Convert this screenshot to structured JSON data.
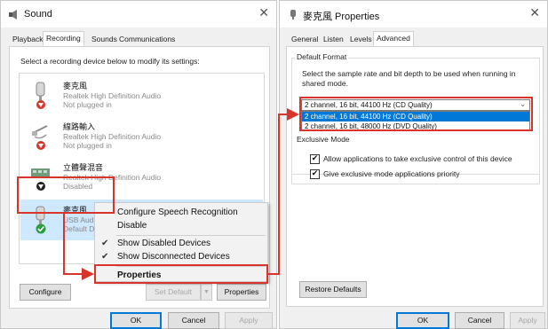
{
  "sound_dialog": {
    "title": "Sound",
    "close_glyph": "✕",
    "tabs": [
      "Playback",
      "Recording",
      "Sounds",
      "Communications"
    ],
    "active_tab": "Recording",
    "instruction": "Select a recording device below to modify its settings:",
    "devices": [
      {
        "name": "麥克風",
        "description": "Realtek High Definition Audio",
        "status": "Not plugged in",
        "icon": "microphone-icon",
        "badge": "red-down-arrow"
      },
      {
        "name": "線路輸入",
        "description": "Realtek High Definition Audio",
        "status": "Not plugged in",
        "icon": "line-in-icon",
        "badge": "red-down-arrow"
      },
      {
        "name": "立體聲混音",
        "description": "Realtek High Definition Audio",
        "status": "Disabled",
        "icon": "sound-card-icon",
        "badge": "black-down-arrow"
      },
      {
        "name": "麥克風",
        "description": "USB Audio Device",
        "status": "Default Device",
        "icon": "microphone-icon",
        "badge": "green-check"
      }
    ],
    "buttons": {
      "configure": "Configure",
      "set_default": "Set Default",
      "properties": "Properties",
      "ok": "OK",
      "cancel": "Cancel",
      "apply": "Apply"
    },
    "context_menu": [
      {
        "label": "Configure Speech Recognition",
        "checked": false
      },
      {
        "label": "Disable",
        "checked": false
      },
      {
        "label": "Show Disabled Devices",
        "checked": true
      },
      {
        "label": "Show Disconnected Devices",
        "checked": true
      },
      {
        "label": "Properties",
        "checked": false,
        "bold": true
      }
    ]
  },
  "properties_dialog": {
    "title": "麥克風 Properties",
    "close_glyph": "✕",
    "tabs": [
      "General",
      "Listen",
      "Levels",
      "Advanced"
    ],
    "active_tab": "Advanced",
    "default_format": {
      "group_label": "Default Format",
      "description": "Select the sample rate and bit depth to be used when running in shared mode.",
      "selected": "2 channel, 16 bit, 44100 Hz (CD Quality)",
      "options": [
        "2 channel, 16 bit, 44100 Hz (CD Quality)",
        "2 channel, 16 bit, 48000 Hz (DVD Quality)"
      ]
    },
    "exclusive_mode": {
      "group_label": "Exclusive Mode",
      "allow_exclusive": "Allow applications to take exclusive control of this device",
      "give_priority": "Give exclusive mode applications priority"
    },
    "buttons": {
      "restore_defaults": "Restore Defaults",
      "ok": "OK",
      "cancel": "Cancel",
      "apply": "Apply"
    }
  },
  "colors": {
    "highlight_red": "#d9342b",
    "selection_blue": "#cde8ff",
    "accent_blue": "#0078d7"
  }
}
